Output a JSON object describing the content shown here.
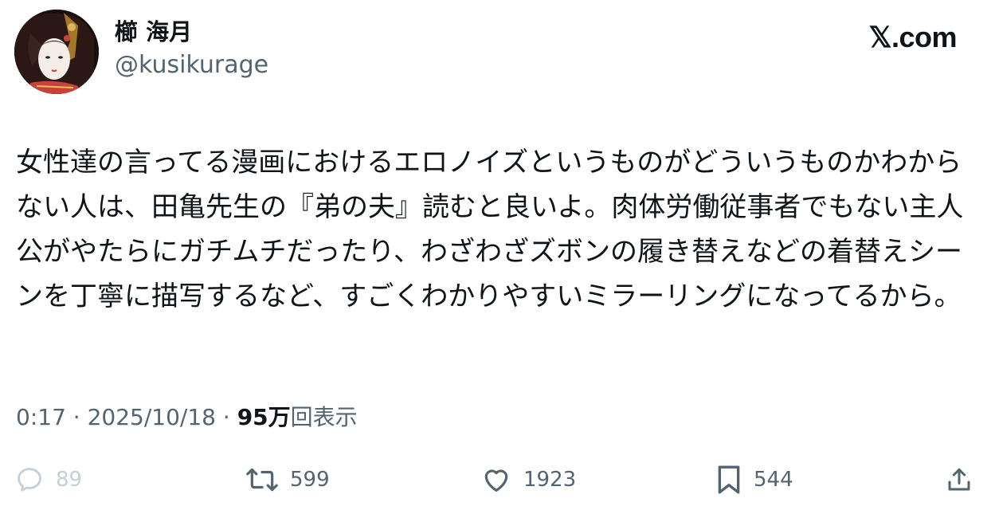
{
  "header": {
    "display_name": "櫛 海月",
    "handle": "@kusikurage",
    "brand": "𝕏.com"
  },
  "tweet": {
    "text": "女性達の言ってる漫画におけるエロノイズというものがどういうものかわからない人は、田亀先生の『弟の夫』読むと良いよ。肉体労働従事者でもない主人公がやたらにガチムチだったり、わざわざズボンの履き替えなどの着替えシーンを丁寧に描写するなど、すごくわかりやすいミラーリングになってるから。"
  },
  "meta": {
    "time": "0:17",
    "separator": " · ",
    "date": "2025/10/18",
    "views_count": "95万",
    "views_label": "回表示"
  },
  "actions": {
    "replies": "89",
    "retweets": "599",
    "likes": "1923",
    "bookmarks": "544"
  },
  "icons": {
    "reply": "reply-icon",
    "retweet": "retweet-icon",
    "like": "heart-icon",
    "bookmark": "bookmark-icon",
    "share": "share-icon"
  },
  "colors": {
    "text": "#0f1419",
    "secondary": "#536471",
    "disabled": "#c4cfd6"
  }
}
